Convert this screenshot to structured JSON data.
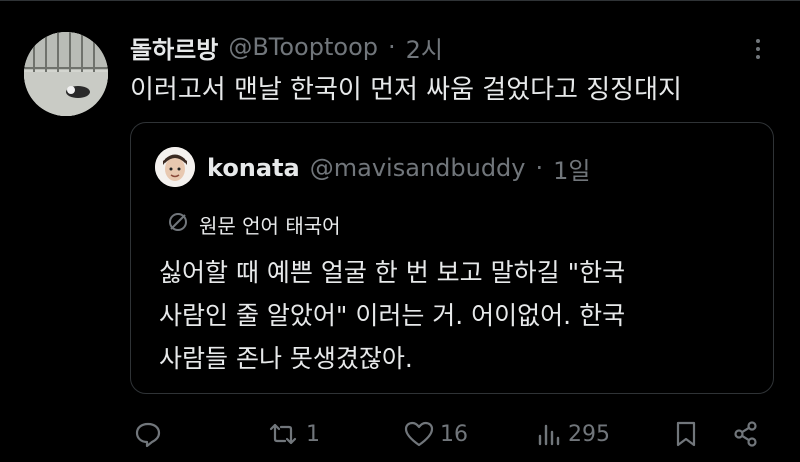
{
  "tweet": {
    "display_name": "돌하르방",
    "handle": "@BTooptoop",
    "separator": "·",
    "time": "2시",
    "text": "이러고서 맨날 한국이 먼저 싸움 걸었다고 징징대지"
  },
  "quoted": {
    "display_name": "konata",
    "handle": "@mavisandbuddy",
    "separator": "·",
    "time": "1일",
    "translation_note": "원문 언어 태국어",
    "lines": [
      "싫어할 때 예쁜 얼굴 한 번 보고 말하길 \"한국",
      "사람인 줄 알았어\" 이러는 거. 어이없어. 한국",
      "사람들 존나 못생겼잖아."
    ]
  },
  "actions": {
    "retweets": "1",
    "likes": "16",
    "views": "295"
  },
  "icons": [
    "more-dots-icon",
    "globe-icon",
    "reply-icon",
    "retweet-icon",
    "heart-icon",
    "views-icon",
    "bookmark-icon",
    "share-icon"
  ]
}
